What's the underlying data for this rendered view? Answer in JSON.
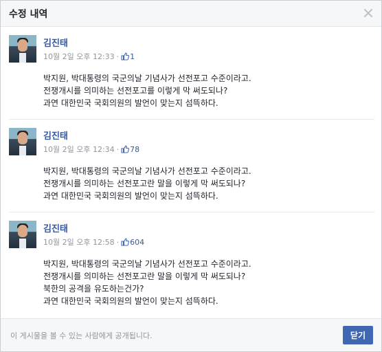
{
  "dialog": {
    "title": "수정 내역",
    "footer_note": "이 게시물을 볼 수 있는 사람에게 공개됩니다.",
    "close_button_label": "닫기"
  },
  "revisions": [
    {
      "author": "김진태",
      "timestamp": "10월 2일 오후 12:33",
      "likes": "1",
      "lines": [
        "박지원, 박대통령의 국군의날 기념사가 선전포고 수준이라고.",
        "전쟁개시를 의미하는 선전포고를 이렇게 막 써도되나?",
        "과연 대한민국 국회의원의 발언이 맞는지 섬뜩하다."
      ]
    },
    {
      "author": "김진태",
      "timestamp": "10월 2일 오후 12:34",
      "likes": "78",
      "lines": [
        "박지원, 박대통령의 국군의날 기념사가 선전포고 수준이라고.",
        "전쟁개시를 의미하는 선전포고란 말을 이렇게 막 써도되나?",
        "과연 대한민국 국회의원의 발언이 맞는지 섬뜩하다."
      ]
    },
    {
      "author": "김진태",
      "timestamp": "10월 2일 오후 12:58",
      "likes": "604",
      "lines": [
        "박지원, 박대통령의 국군의날 기념사가 선전포고 수준이라고.",
        "전쟁개시를 의미하는 선전포고란 말을 이렇게 막 써도되나?",
        "북한의 공격을 유도하는건가?",
        "과연 대한민국 국회의원의 발언이 맞는지 섬뜩하다."
      ]
    }
  ],
  "colors": {
    "link": "#365899",
    "button": "#4267b2",
    "meta": "#90949c"
  }
}
